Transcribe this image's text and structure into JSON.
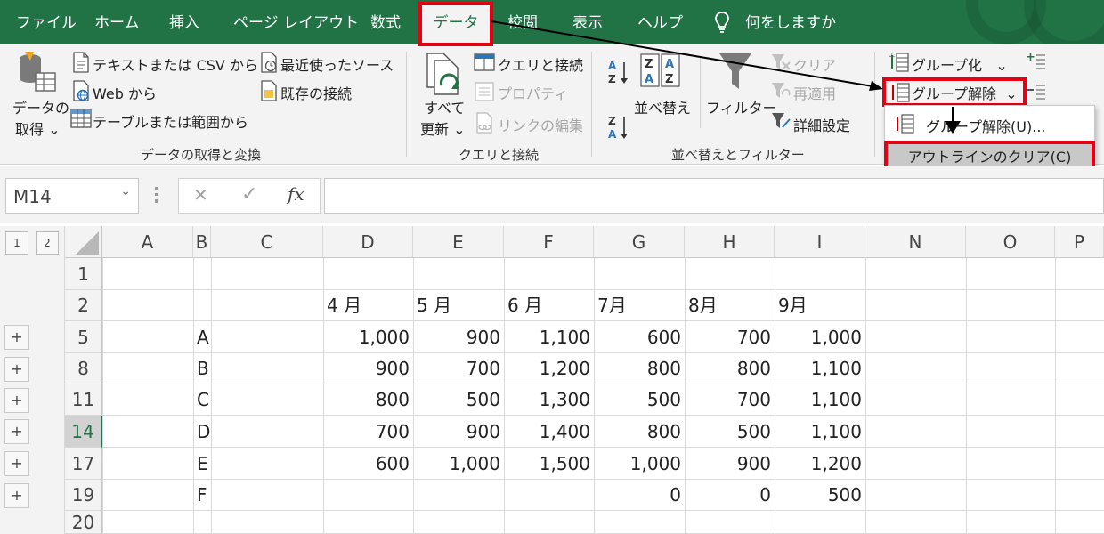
{
  "tabs": {
    "file": "ファイル",
    "home": "ホーム",
    "insert": "挿入",
    "page_layout": "ページ レイアウト",
    "formulas": "数式",
    "data": "データ",
    "review": "校閲",
    "view": "表示",
    "help": "ヘルプ",
    "tell_me": "何をしますか"
  },
  "ribbon": {
    "get_data_line1": "データの",
    "get_data_line2": "取得",
    "from_text_csv": "テキストまたは CSV から",
    "from_web": "Web から",
    "from_table": "テーブルまたは範囲から",
    "recent_sources": "最近使ったソース",
    "existing_connections": "既存の接続",
    "group_get_transform": "データの取得と変換",
    "refresh_all_line1": "すべて",
    "refresh_all_line2": "更新",
    "queries_connections": "クエリと接続",
    "properties": "プロパティ",
    "edit_links": "リンクの編集",
    "group_queries": "クエリと接続",
    "sort": "並べ替え",
    "filter": "フィルター",
    "clear": "クリア",
    "reapply": "再適用",
    "advanced": "詳細設定",
    "group_sort_filter": "並べ替えとフィルター",
    "group_btn": "グループ化",
    "ungroup_btn": "グループ解除",
    "caret": "⌄"
  },
  "dropdown": {
    "ungroup_item": "グループ解除(U)...",
    "clear_outline": "アウトラインのクリア(C)"
  },
  "formula_bar": {
    "name_box": "M14",
    "cancel": "✕",
    "enter": "✓",
    "fx": "fx",
    "formula": ""
  },
  "outline_levels": [
    "1",
    "2"
  ],
  "columns": [
    "A",
    "B",
    "C",
    "D",
    "E",
    "F",
    "G",
    "H",
    "I",
    "N",
    "O",
    "P"
  ],
  "rows": [
    "1",
    "2",
    "5",
    "8",
    "11",
    "14",
    "17",
    "19",
    "20"
  ],
  "selected_row": "14",
  "expand_buttons": [
    "+",
    "+",
    "+",
    "+",
    "+",
    "+"
  ],
  "month_headers": [
    "4 月",
    "5 月",
    "6 月",
    "7月",
    "8月",
    "9月"
  ],
  "table": [
    {
      "label": "A",
      "values": [
        "1,000",
        "900",
        "1,100",
        "600",
        "700",
        "1,000"
      ]
    },
    {
      "label": "B",
      "values": [
        "900",
        "700",
        "1,200",
        "800",
        "800",
        "1,100"
      ]
    },
    {
      "label": "C",
      "values": [
        "800",
        "500",
        "1,300",
        "500",
        "700",
        "1,100"
      ]
    },
    {
      "label": "D",
      "values": [
        "700",
        "900",
        "1,400",
        "800",
        "500",
        "1,100"
      ]
    },
    {
      "label": "E",
      "values": [
        "600",
        "1,000",
        "1,500",
        "1,000",
        "900",
        "1,200"
      ]
    },
    {
      "label": "F",
      "values": [
        "",
        "",
        "",
        "0",
        "0",
        "500"
      ]
    }
  ],
  "colors": {
    "excel_green": "#217346",
    "highlight_red": "#e60012"
  }
}
